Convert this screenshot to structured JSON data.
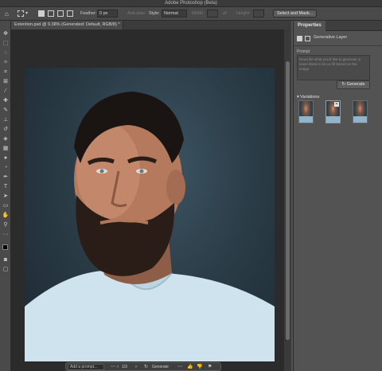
{
  "window": {
    "title": "Adobe Photoshop (Beta)"
  },
  "options_bar": {
    "feather_label": "Feather:",
    "feather_value": "0 px",
    "anti_alias_label": "Anti-alias",
    "style_label": "Style:",
    "style_value": "Normal",
    "width_label": "Width:",
    "height_label": "Height:",
    "select_mask_label": "Select and Mask..."
  },
  "document": {
    "tab_label": "Extention.psd @ 9.38% (Generated: Default, RGB/8) *"
  },
  "task_bar": {
    "prompt_placeholder": "Add a prompt...",
    "page_indicator": "1/3",
    "generate_label": "Generate"
  },
  "properties": {
    "tab_label": "Properties",
    "layer_name": "Generative Layer",
    "prompt_label": "Prompt",
    "prompt_placeholder": "Describe what you'd like to generate or leave blank to let us fill based on the image",
    "generate_label": "Generate",
    "variations_label": "Variations"
  },
  "colors": {
    "ui_dark": "#2b2b2b",
    "panel": "#535353",
    "backdrop": "#2b3d48",
    "shirt": "#cfe3ef"
  }
}
